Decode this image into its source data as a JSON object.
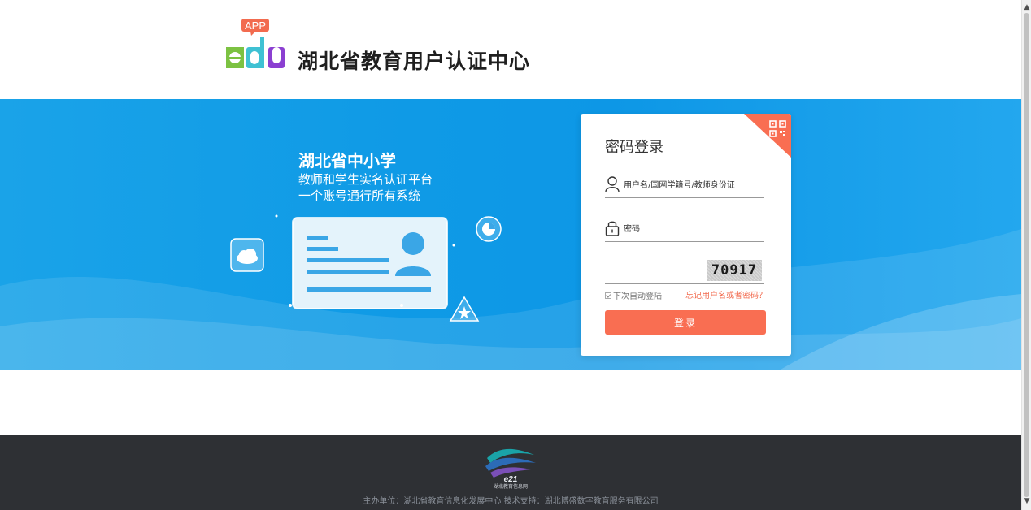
{
  "header": {
    "logo_badge": "APP",
    "logo_word": "edu",
    "title": "湖北省教育用户认证中心"
  },
  "banner": {
    "slogan_main": "湖北省中小学",
    "slogan_line1": "教师和学生实名认证平台",
    "slogan_line2": "一个账号通行所有系统"
  },
  "login": {
    "title": "密码登录",
    "username_placeholder": "用户名/国网学籍号/教师身份证",
    "password_placeholder": "密码",
    "captcha_code": "70917",
    "remember_label": "下次自动登陆",
    "forgot_link": "忘记用户名或者密码？",
    "submit_label": "登录",
    "accent_color": "#f96e52"
  },
  "footer": {
    "logo_text": "e21",
    "logo_caption": "湖北教育信息网",
    "text": "主办单位：湖北省教育信息化发展中心 技术支持：湖北博盛数字教育服务有限公司"
  },
  "colors": {
    "banner_blue": "#0f9ae6",
    "footer_bg": "#2e3034",
    "logo_green": "#7cc242",
    "logo_teal": "#3fc1d3",
    "logo_purple": "#8b3fd1",
    "logo_badge": "#f26b4f"
  }
}
